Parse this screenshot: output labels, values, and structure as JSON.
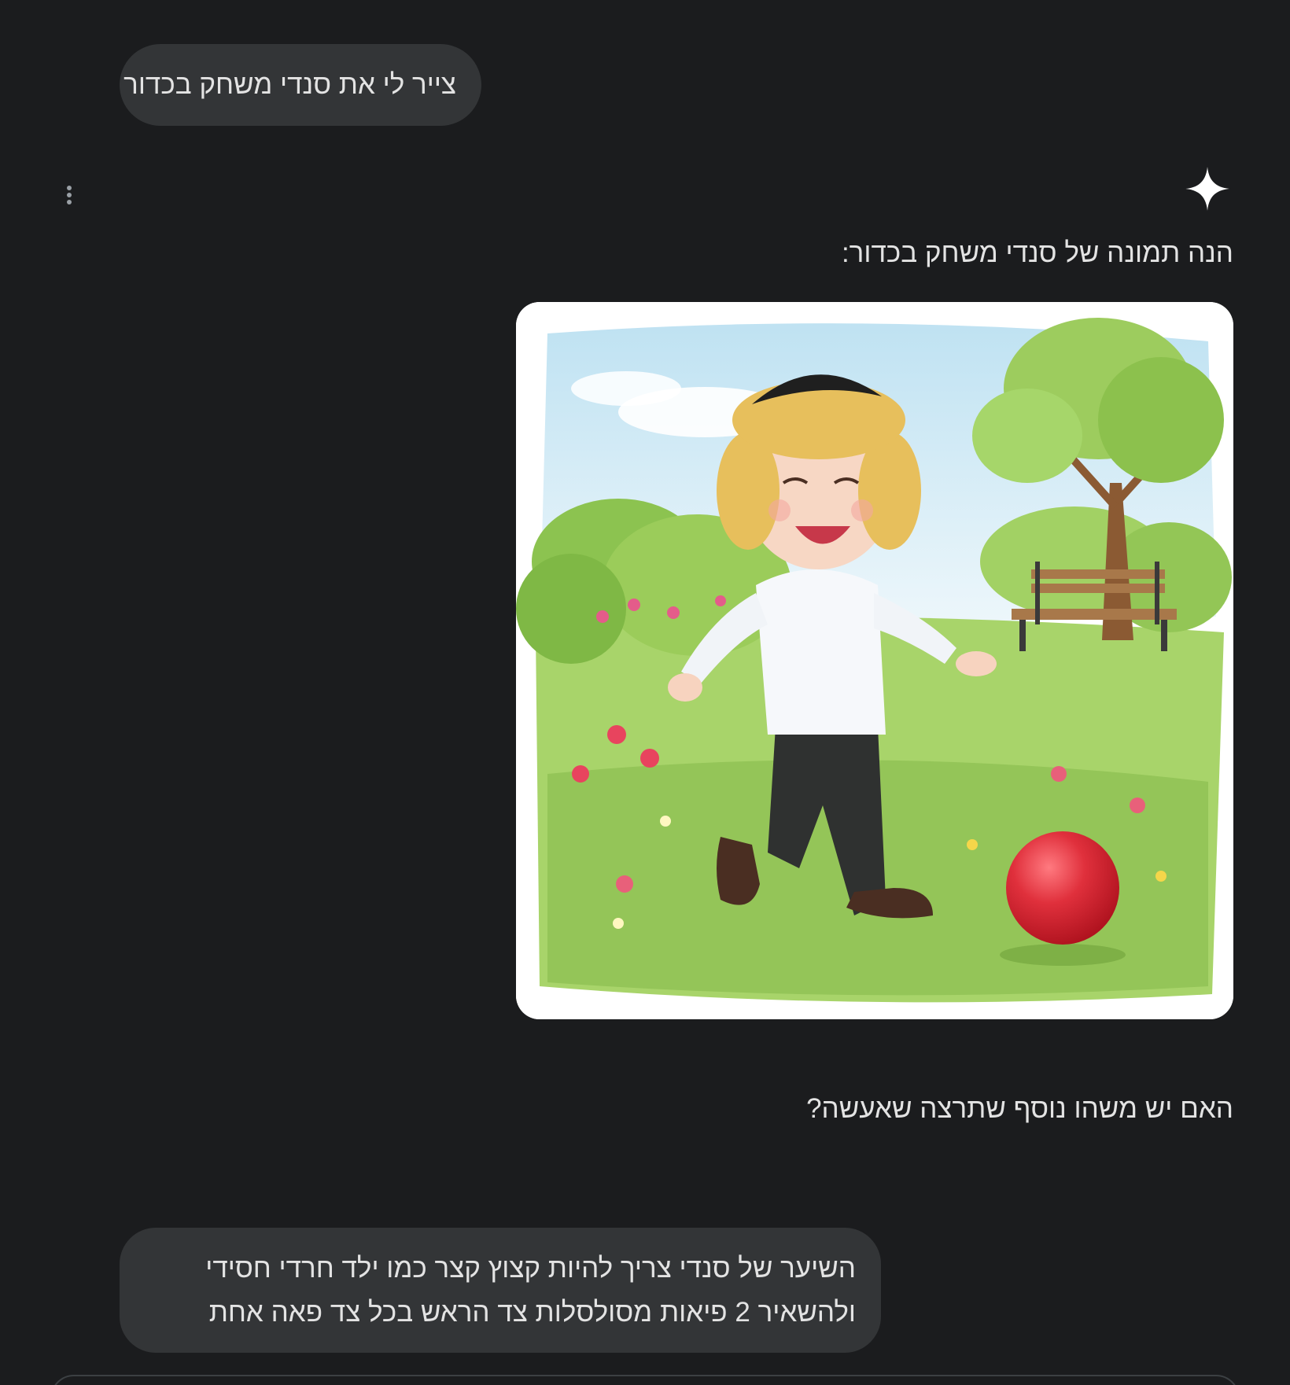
{
  "conversation": {
    "user_message_1": "צייר לי את סנדי משחק בכדור",
    "assistant": {
      "logo_icon": "gemini-spark-icon",
      "menu_icon": "more-vertical-icon",
      "intro_text": "הנה תמונה של סנדי משחק בכדור:",
      "image_description_icon": "generated-illustration",
      "followup_text": "האם יש משהו נוסף שתרצה שאעשה?"
    },
    "user_message_2": "השיער של סנדי צריך להיות קצוץ קצר כמו ילד חרדי חסידי ולהשאיר 2 פיאות מסולסלות צד הראש בכל צד פאה אחת"
  },
  "colors": {
    "background": "#1b1c1e",
    "bubble": "#333537",
    "text": "#e3e3e3",
    "ball": "#d62a36"
  }
}
